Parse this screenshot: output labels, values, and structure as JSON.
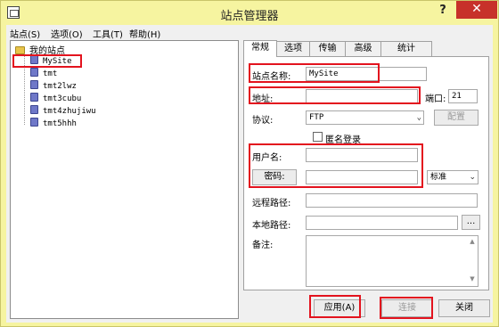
{
  "window": {
    "title": "站点管理器",
    "help_label": "?",
    "close_label": "✕",
    "accent_highlight": "#e3131e"
  },
  "menu": {
    "items": [
      {
        "label": "站点(S)"
      },
      {
        "label": "选项(O)"
      },
      {
        "label": "工具(T)"
      },
      {
        "label": "帮助(H)"
      }
    ]
  },
  "tree": {
    "root_label": "我的站点",
    "items": [
      {
        "label": "MySite"
      },
      {
        "label": "tmt"
      },
      {
        "label": "tmt2lwz"
      },
      {
        "label": "tmt3cubu"
      },
      {
        "label": "tmt4zhujiwu"
      },
      {
        "label": "tmt5hhh"
      }
    ]
  },
  "tabs": [
    {
      "label": "常规"
    },
    {
      "label": "选项"
    },
    {
      "label": "传输"
    },
    {
      "label": "高级"
    },
    {
      "label": "统计"
    }
  ],
  "form": {
    "site_name_label": "站点名称:",
    "site_name_value": "MySite",
    "address_label": "地址:",
    "address_value": "",
    "port_label": "端口:",
    "port_value": "21",
    "protocol_label": "协议:",
    "protocol_value": "FTP",
    "config_button": "配置",
    "anonymous_label": "匿名登录",
    "username_label": "用户名:",
    "username_value": "",
    "password_button": "密码:",
    "password_value": "",
    "auth_mode_value": "标准",
    "remote_path_label": "远程路径:",
    "remote_path_value": "",
    "local_path_label": "本地路径:",
    "local_path_value": "",
    "browse_button": "...",
    "notes_label": "备注:"
  },
  "footer": {
    "apply_button": "应用(A)",
    "connect_button": "连接",
    "close_button": "关闭"
  }
}
